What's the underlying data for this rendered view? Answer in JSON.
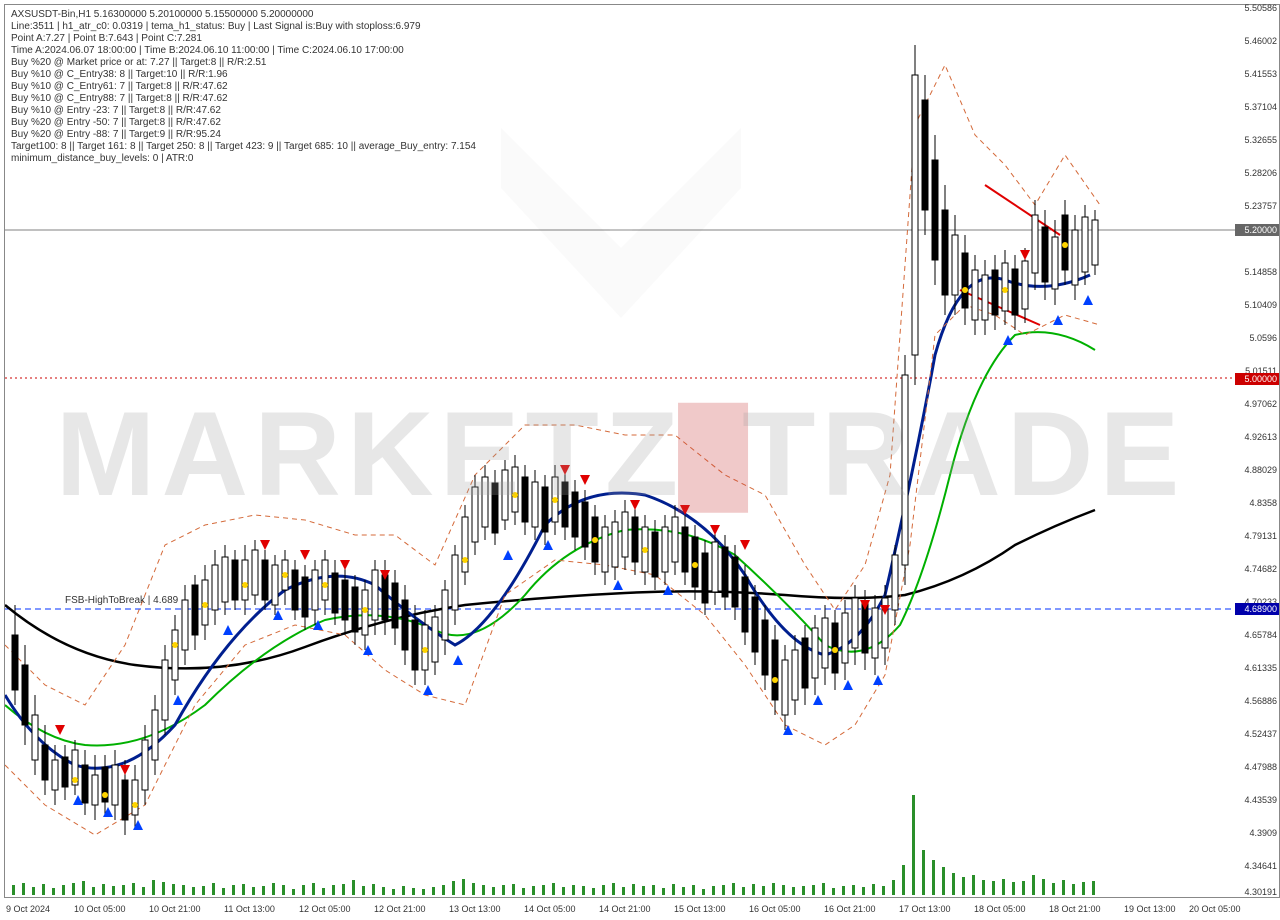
{
  "chart_data": {
    "type": "candlestick",
    "symbol": "AXSUSDT-Bin",
    "timeframe": "H1",
    "title": "AXSUSDT-Bin, H1   5.16300000 5.20100000 5.15500000 5.20000000",
    "ohlc": {
      "open": 5.163,
      "high": 5.201,
      "low": 5.155,
      "close": 5.2
    },
    "ylim": [
      4.30191,
      5.50586
    ],
    "yticks": [
      5.50586,
      5.46002,
      5.41553,
      5.37104,
      5.32655,
      5.28206,
      5.23757,
      5.2,
      5.14858,
      5.10409,
      5.0596,
      5.01511,
      5.0,
      4.97062,
      4.92613,
      4.88029,
      4.8358,
      4.79131,
      4.74682,
      4.70233,
      4.689,
      4.65784,
      4.61335,
      4.56886,
      4.52437,
      4.47988,
      4.43539,
      4.3909,
      4.34641,
      4.30191
    ],
    "xticks": [
      "9 Oct 2024",
      "10 Oct 05:00",
      "10 Oct 21:00",
      "11 Oct 13:00",
      "12 Oct 05:00",
      "12 Oct 21:00",
      "13 Oct 13:00",
      "14 Oct 05:00",
      "14 Oct 21:00",
      "15 Oct 13:00",
      "16 Oct 05:00",
      "16 Oct 21:00",
      "17 Oct 13:00",
      "18 Oct 05:00",
      "18 Oct 21:00",
      "19 Oct 13:00",
      "20 Oct 05:00"
    ],
    "hlines": [
      {
        "name": "current",
        "value": 5.2,
        "color": "#888",
        "style": "solid"
      },
      {
        "name": "alert",
        "value": 5.0,
        "color": "#c00",
        "style": "dotted"
      },
      {
        "name": "fsb",
        "value": 4.689,
        "color": "#00f",
        "style": "dashed",
        "label": "FSB-HighToBreak | 4.689"
      }
    ],
    "indicators": [
      {
        "name": "MA-black",
        "color": "#000",
        "type": "line"
      },
      {
        "name": "MA-blue",
        "color": "#001f8f",
        "type": "line"
      },
      {
        "name": "MA-green",
        "color": "#00b000",
        "type": "line"
      },
      {
        "name": "Channel",
        "color": "#d46a3a",
        "type": "band-dashed"
      },
      {
        "name": "Volume",
        "color": "#2a8f2a",
        "type": "bars"
      }
    ],
    "signals": {
      "up_arrow": "#0040ff",
      "down_arrow": "#e00000",
      "dot": "#ffd400"
    },
    "series_summary": [
      {
        "t": "9 Oct",
        "o": 4.6,
        "h": 4.62,
        "l": 4.42,
        "c": 4.46
      },
      {
        "t": "10 Oct",
        "o": 4.46,
        "h": 4.57,
        "l": 4.4,
        "c": 4.54
      },
      {
        "t": "11 Oct",
        "o": 4.54,
        "h": 4.8,
        "l": 4.5,
        "c": 4.76
      },
      {
        "t": "12 Oct",
        "o": 4.76,
        "h": 4.8,
        "l": 4.61,
        "c": 4.64
      },
      {
        "t": "13 Oct",
        "o": 4.64,
        "h": 4.88,
        "l": 4.6,
        "c": 4.85
      },
      {
        "t": "14 Oct",
        "o": 4.85,
        "h": 4.92,
        "l": 4.78,
        "c": 4.82
      },
      {
        "t": "15 Oct",
        "o": 4.82,
        "h": 4.88,
        "l": 4.7,
        "c": 4.76
      },
      {
        "t": "16 Oct",
        "o": 4.76,
        "h": 4.82,
        "l": 4.68,
        "c": 4.7
      },
      {
        "t": "17 Oct",
        "o": 4.7,
        "h": 4.72,
        "l": 4.5,
        "c": 4.6
      },
      {
        "t": "18 Oct",
        "o": 4.6,
        "h": 5.47,
        "l": 4.58,
        "c": 5.2
      },
      {
        "t": "19 Oct",
        "o": 5.2,
        "h": 5.36,
        "l": 5.04,
        "c": 5.15
      },
      {
        "t": "20 Oct",
        "o": 5.15,
        "h": 5.24,
        "l": 5.1,
        "c": 5.2
      }
    ]
  },
  "info_lines": [
    "AXSUSDT-Bin,H1   5.16300000 5.20100000 5.15500000 5.20000000",
    "Line:3511  |  h1_atr_c0: 0.0319  |  tema_h1_status: Buy  |  Last Signal is:Buy with stoploss:6.979",
    "Point A:7.27  |  Point B:7.643  |  Point C:7.281",
    "Time A:2024.06.07 18:00:00  |  Time B:2024.06.10 11:00:00  |  Time C:2024.06.10 17:00:00",
    "Buy %20 @ Market price or at: 7.27  ||  Target:8  ||  R/R:2.51",
    "Buy %10 @ C_Entry38: 8  ||  Target:10  ||  R/R:1.96",
    "Buy %10 @ C_Entry61: 7  ||  Target:8  ||  R/R:47.62",
    "Buy %10 @ C_Entry88: 7  ||  Target:8  ||  R/R:47.62",
    "Buy %10 @ Entry -23: 7  ||  Target:8  ||  R/R:47.62",
    "Buy %20 @ Entry -50: 7  ||  Target:8  ||  R/R:47.62",
    "Buy %20 @ Entry -88: 7  ||  Target:9  ||  R/R:95.24",
    "Target100: 8  ||  Target 161: 8  ||  Target 250: 8  ||  Target 423: 9  ||  Target 685: 10  ||  average_Buy_entry: 7.154",
    "minimum_distance_buy_levels: 0  |  ATR:0"
  ],
  "fsb_label": "FSB-HighToBreak | 4.689",
  "price_tags": {
    "current": "5.20000",
    "alert": "5.00000",
    "fsb": "4.68900"
  },
  "watermark": "MARKETZ TRADE"
}
